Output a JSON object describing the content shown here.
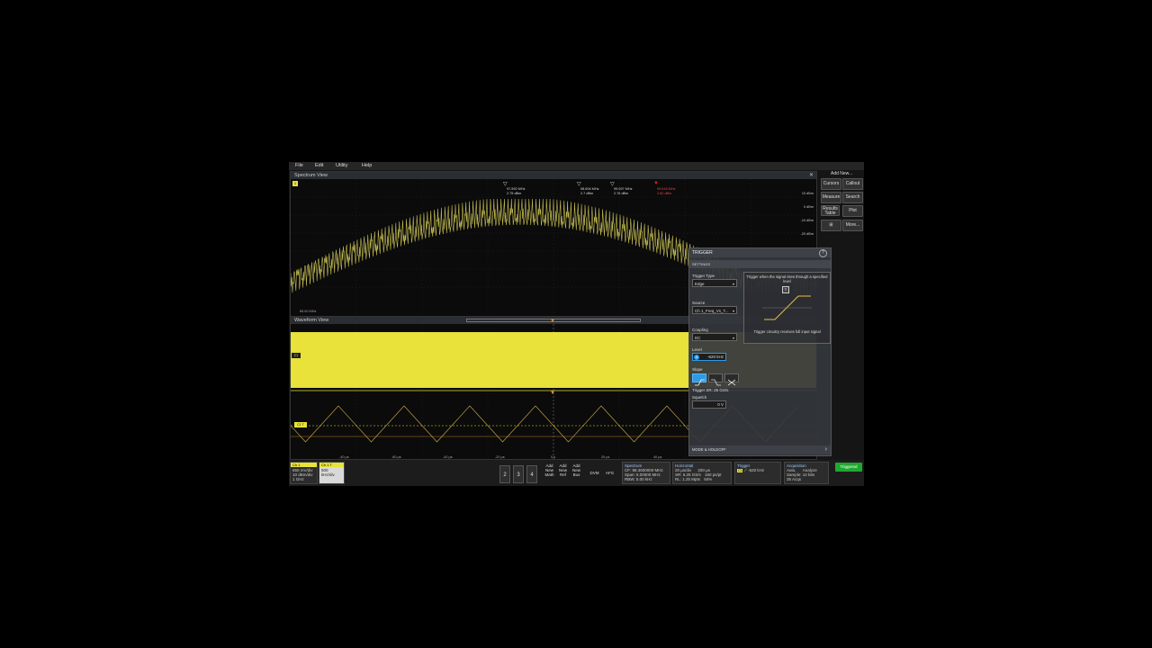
{
  "menu": {
    "file": "File",
    "edit": "Edit",
    "utility": "Utility",
    "help": "Help"
  },
  "spectrum": {
    "title": "Spectrum View",
    "left_badge": "1",
    "start_label": "65.00 MHz",
    "markers": [
      {
        "freq": "97.592 MHz",
        "level": "2.75 dBm"
      },
      {
        "freq": "98.694 MHz",
        "level": "2.7 dBm"
      },
      {
        "freq": "99.097 MHz",
        "level": "2.76 dBm"
      },
      {
        "freq": "99.618 MHz",
        "level": "2.82 dBm"
      }
    ],
    "y_ticks": [
      "10 dBm",
      "0 dBm",
      "-10 dBm",
      "-20 dBm"
    ]
  },
  "waveform": {
    "title": "Waveform View",
    "ch1_badge": "C1",
    "ch_ref_badge": "C1 T",
    "x_ticks": [
      "-40 µs",
      "-60 µs",
      "-40 µs",
      "-20 µs",
      "0 s",
      "20 µs",
      "40 µs"
    ]
  },
  "right_panel": {
    "add_new": "Add New...",
    "cursors": "Cursors",
    "callout": "Callout",
    "measure": "Measure",
    "search": "Search",
    "results_table": "Results Table",
    "plot": "Plot",
    "more": "More..."
  },
  "trigger": {
    "title": "TRIGGER",
    "settings": "SETTINGS",
    "type_label": "Trigger Type",
    "type_value": "Edge",
    "source_label": "Source",
    "source_value": "Ch 1_Freq_Vs_T...",
    "coupling_label": "Coupling",
    "coupling_value": "DC",
    "level_label": "Level",
    "level_value": "-620 kHz",
    "slope_label": "Slope",
    "sr_note": "Trigger SR: 25 GS/s",
    "squelch_label": "Squelch",
    "squelch_value": "0 V",
    "info_top": "Trigger when the signal rises through a specified level",
    "info_bottom": "Trigger circuitry receives full input signal",
    "mode_holdoff": "MODE & HOLDOFF"
  },
  "bottom": {
    "ch1": {
      "title": "Ch 1",
      "l1": "650 mV/div",
      "l2": "10 dBm/div",
      "l3": "1 GHz"
    },
    "ch1b": {
      "title": "Ch 1 T",
      "l1": "500 kHz/div"
    },
    "btn2": "2",
    "btn3": "3",
    "btn4": "4",
    "add_math": "Add New Math",
    "add_ref": "Add New Ref",
    "add_bus": "Add New Bus",
    "dvm": "DVM",
    "afg": "AFG",
    "spectrum": {
      "title": "Spectrum",
      "l1": "CF: 98.4600000 MHz",
      "l2": "Span: 5.00000 MHz",
      "l3": "RBW: 5.00 kHz"
    },
    "horizontal": {
      "title": "Horizontal",
      "l1": "20 µs/div",
      "l1b": "200 µs",
      "l2": "SR: 6.25 GS/s",
      "l2b": "160 ps/pt",
      "l3": "RL: 1.25 Mpts",
      "l3b": "50%"
    },
    "trigger": {
      "title": "Trigger",
      "l1": "-620 kHz"
    },
    "acquisition": {
      "title": "Acquisition",
      "l1": "Auto,",
      "l1b": "Analyze",
      "l2": "Sample: 12 bits",
      "l3": "35 Acqs"
    },
    "triggered": "Triggered"
  },
  "colors": {
    "ch1": "#e8e23a",
    "accent": "#2b9be6",
    "triggered": "#1fa82f",
    "marker_red": "#e02020"
  }
}
